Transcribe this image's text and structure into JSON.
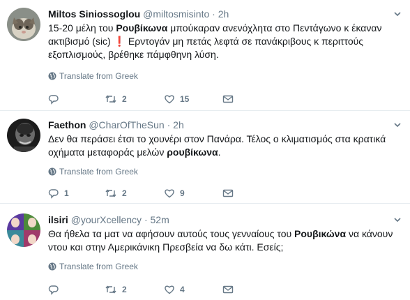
{
  "ui": {
    "translate_label": "Translate from Greek"
  },
  "tweets": [
    {
      "name": "Miltos Siniossoglou",
      "handle": "@miltosmisinto",
      "dot": "·",
      "time": "2h",
      "text_parts": [
        "15-20 μέλη του ",
        "Ρουβίκωνα",
        " μπούκαραν ανενόχλητα στο Πεντάγωνο κ έκαναν ακτιβισμό (sic) ",
        "❗",
        " Ερντογάν μη πετάς λεφτά σε πανάκριβους κ περιττούς εξοπλισμούς, βρέθηκε πάμφθηνη λύση."
      ],
      "counts": {
        "reply": "",
        "retweet": "2",
        "like": "15"
      }
    },
    {
      "name": "Faethon",
      "handle": "@CharOfTheSun",
      "dot": "·",
      "time": "2h",
      "text_parts": [
        "Δεν θα περάσει έτσι το χουνέρι στον Πανάρα. Τέλος ο κλιματισμός στα κρατικά οχήματα μεταφοράς μελών ",
        "ρουβίκωνα",
        "."
      ],
      "counts": {
        "reply": "1",
        "retweet": "2",
        "like": "9"
      }
    },
    {
      "name": "ilsiri",
      "handle": "@yourXcellency",
      "dot": "·",
      "time": "52m",
      "text_parts": [
        "Θα ήθελα τα ματ να αφήσουν αυτούς τους γενναίους του ",
        "Ρουβικώνα",
        " να κάνουν ντου και στην Αμερικάνικη Πρεσβεία να δω κάτι. Εσείς;"
      ],
      "counts": {
        "reply": "",
        "retweet": "2",
        "like": "4"
      }
    }
  ],
  "colors": {
    "text": "#14171a",
    "secondary": "#657786",
    "divider": "#e6ecf0",
    "alert": "#d6001c"
  },
  "icons": [
    "chevron-down-icon",
    "globe-icon",
    "reply-icon",
    "retweet-icon",
    "like-icon",
    "dm-icon"
  ]
}
